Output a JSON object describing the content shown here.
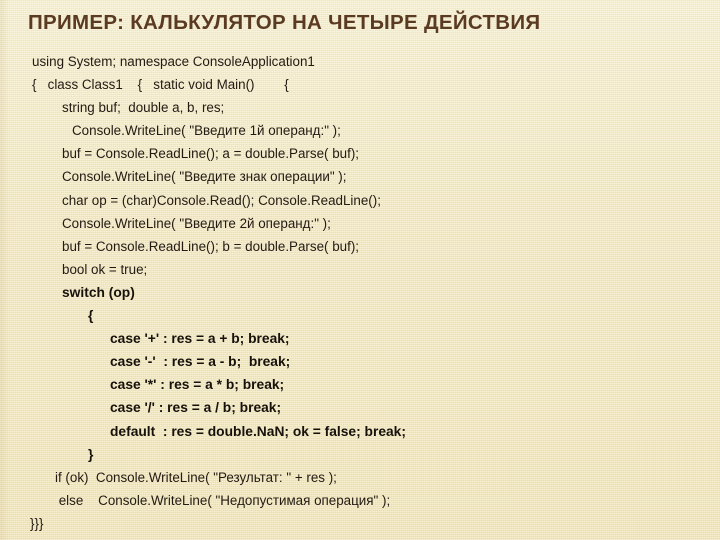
{
  "slide": {
    "title": "ПРИМЕР: КАЛЬКУЛЯТОР НА ЧЕТЫРЕ ДЕЙСТВИЯ",
    "background_color": "#f2e8c0",
    "title_color": "#5b3a22",
    "code_color": "#231a12"
  },
  "code": {
    "language": "csharp",
    "lines": [
      {
        "text": "using System; namespace ConsoleApplication1",
        "indent": 1,
        "bold": false
      },
      {
        "text": "{   class Class1    {   static void Main()        {",
        "indent": 1,
        "bold": false
      },
      {
        "text": "string buf;  double a, b, res;",
        "indent": 3,
        "bold": false
      },
      {
        "text": "Console.WriteLine( \"Введите 1й операнд:\" );",
        "indent": 4,
        "bold": false
      },
      {
        "text": "buf = Console.ReadLine(); a = double.Parse( buf);",
        "indent": 3,
        "bold": false
      },
      {
        "text": "Console.WriteLine( \"Введите знак операции\" );",
        "indent": 3,
        "bold": false
      },
      {
        "text": "char op = (char)Console.Read(); Console.ReadLine();",
        "indent": 3,
        "bold": false
      },
      {
        "text": "Console.WriteLine( \"Введите 2й операнд:\" );",
        "indent": 3,
        "bold": false
      },
      {
        "text": "buf = Console.ReadLine(); b = double.Parse( buf);",
        "indent": 3,
        "bold": false
      },
      {
        "text": "bool ok = true;",
        "indent": 3,
        "bold": false
      },
      {
        "text": "switch (op)",
        "indent": 3,
        "bold": true
      },
      {
        "text": "{",
        "indent": 5,
        "bold": true
      },
      {
        "text": "case '+' : res = a + b; break;",
        "indent": 6,
        "bold": true
      },
      {
        "text": "case '-'  : res = a - b;  break;",
        "indent": 6,
        "bold": true
      },
      {
        "text": "case '*' : res = a * b; break;",
        "indent": 6,
        "bold": true
      },
      {
        "text": "case '/' : res = a / b; break;",
        "indent": 6,
        "bold": true
      },
      {
        "text": "default  : res = double.NaN; ok = false; break;",
        "indent": 6,
        "bold": true
      },
      {
        "text": "}",
        "indent": 5,
        "bold": true
      },
      {
        "text": "if (ok)  Console.WriteLine( \"Результат: \" + res );",
        "indent": 2,
        "bold": false
      },
      {
        "text": " else    Console.WriteLine( \"Недопустимая операция\" );",
        "indent": 2,
        "bold": false
      },
      {
        "text": "}}}",
        "indent": 0,
        "bold": false
      }
    ]
  }
}
